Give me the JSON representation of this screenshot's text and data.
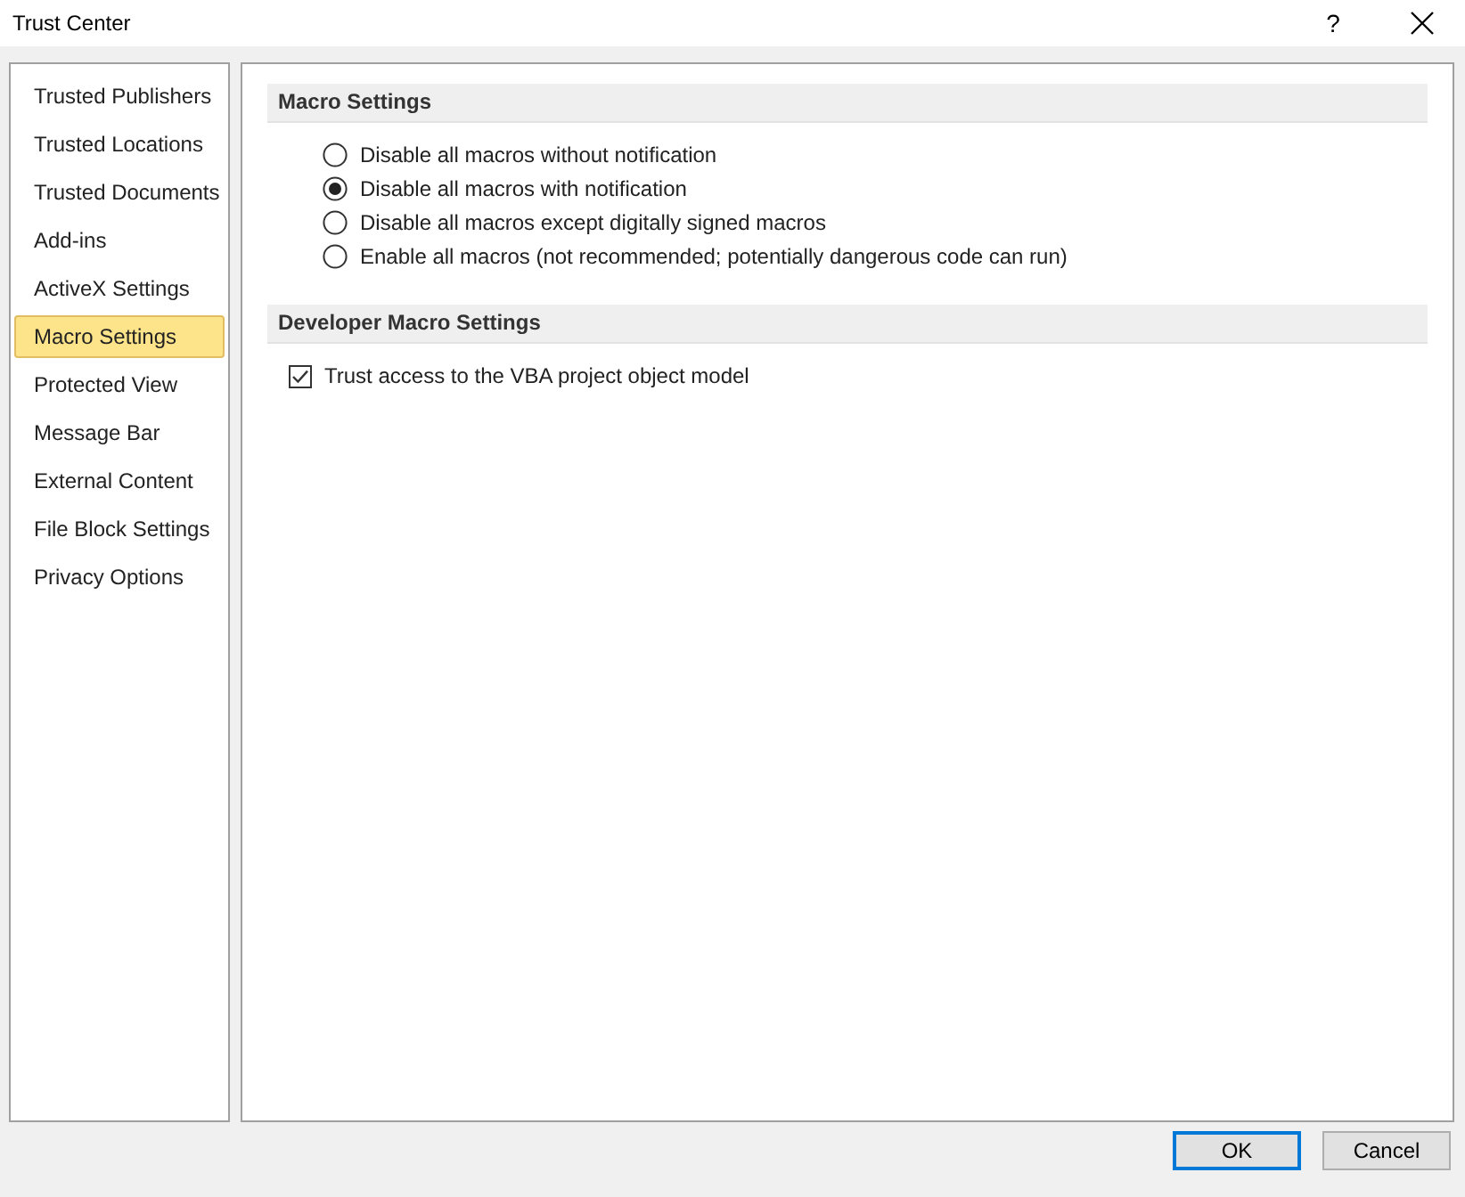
{
  "window": {
    "title": "Trust Center",
    "help": "?"
  },
  "sidebar": {
    "items": [
      {
        "label": "Trusted Publishers",
        "selected": false
      },
      {
        "label": "Trusted Locations",
        "selected": false
      },
      {
        "label": "Trusted Documents",
        "selected": false
      },
      {
        "label": "Add-ins",
        "selected": false
      },
      {
        "label": "ActiveX Settings",
        "selected": false
      },
      {
        "label": "Macro Settings",
        "selected": true
      },
      {
        "label": "Protected View",
        "selected": false
      },
      {
        "label": "Message Bar",
        "selected": false
      },
      {
        "label": "External Content",
        "selected": false
      },
      {
        "label": "File Block Settings",
        "selected": false
      },
      {
        "label": "Privacy Options",
        "selected": false
      }
    ]
  },
  "sections": [
    {
      "title": "Macro Settings",
      "options": [
        {
          "kind": "radio",
          "label": "Disable all macros without notification",
          "selected": false
        },
        {
          "kind": "radio",
          "label": "Disable all macros with notification",
          "selected": true
        },
        {
          "kind": "radio",
          "label": "Disable all macros except digitally signed macros",
          "selected": false
        },
        {
          "kind": "radio",
          "label": "Enable all macros (not recommended; potentially dangerous code can run)",
          "selected": false
        }
      ]
    },
    {
      "title": "Developer Macro Settings",
      "options": [
        {
          "kind": "checkbox",
          "label": "Trust access to the VBA project object model",
          "checked": true
        }
      ]
    }
  ],
  "buttons": [
    {
      "label": "OK",
      "default": true
    },
    {
      "label": "Cancel",
      "default": false
    }
  ]
}
